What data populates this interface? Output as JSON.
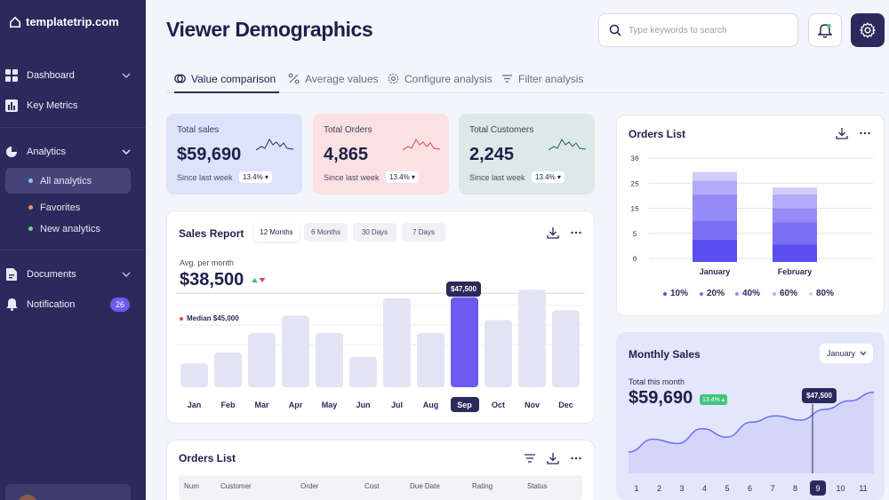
{
  "brand": {
    "name": "templatetrip.com"
  },
  "sidebar": {
    "dashboard": "Dashboard",
    "key_metrics": "Key Metrics",
    "analytics": "Analytics",
    "all_analytics": "All analytics",
    "favorites": "Favorites",
    "new_analytics": "New analytics",
    "documents": "Documents",
    "notification": "Notification",
    "notification_count": "26"
  },
  "header": {
    "title": "Viewer Demographics",
    "search_placeholder": "Type keywords to search"
  },
  "tabs": {
    "value_comparison": "Value comparison",
    "average_values": "Average values",
    "configure_analysis": "Configure analysis",
    "filter_analysis": "Filter analysis"
  },
  "stats": [
    {
      "title": "Total sales",
      "value": "$59,690",
      "since": "Since last week",
      "change": "13.4% ▾",
      "color": "#dde3fb"
    },
    {
      "title": "Total Orders",
      "value": "4,865",
      "since": "Since last week",
      "change": "13.4% ▾",
      "color": "#fbe1e1"
    },
    {
      "title": "Total Customers",
      "value": "2,245",
      "since": "Since last week",
      "change": "13.4% ▾",
      "color": "#dde9e6"
    }
  ],
  "sales_report": {
    "title": "Sales Report",
    "ranges": [
      "12 Months",
      "6 Months",
      "30 Days",
      "7 Days"
    ],
    "selected_range": "12 Months",
    "avg_label": "Avg. per month",
    "avg_value": "$38,500",
    "median_label": "Median $45,000",
    "tooltip": "$47,500",
    "selected_month": "Sep"
  },
  "orders_table": {
    "title": "Orders List",
    "columns": [
      "Num",
      "Customer",
      "Order",
      "Cost",
      "Due Date",
      "Rating",
      "Status"
    ]
  },
  "orders_chart": {
    "title": "Orders List",
    "categories": [
      "January",
      "February"
    ],
    "yticks": [
      "30",
      "25",
      "15",
      "5",
      "0"
    ],
    "legend": [
      "10%",
      "20%",
      "40%",
      "60%",
      "80%"
    ],
    "colors": [
      "#5b4ef0",
      "#7a6ef5",
      "#958bf7",
      "#b2abf9",
      "#d2cefb"
    ]
  },
  "monthly_sales": {
    "title": "Monthly Sales",
    "month_select": "January",
    "total_label": "Total this month",
    "total_value": "$59,690",
    "change": "13.4% ▴",
    "tooltip": "$47,500",
    "pages": [
      "1",
      "2",
      "3",
      "4",
      "5",
      "6",
      "7",
      "8",
      "9",
      "10",
      "11"
    ],
    "selected_page": "9"
  },
  "chart_data": [
    {
      "type": "bar",
      "categories": [
        "Jan",
        "Feb",
        "Mar",
        "Apr",
        "May",
        "Jun",
        "Jul",
        "Aug",
        "Sep",
        "Oct",
        "Nov",
        "Dec"
      ],
      "values": [
        11000,
        16000,
        25000,
        33000,
        25000,
        14000,
        41000,
        25000,
        41500,
        31000,
        45000,
        35500
      ],
      "highlight": "Sep",
      "reference_line": 45000,
      "title": "Sales Report"
    },
    {
      "type": "bar",
      "stacked": true,
      "categories": [
        "January",
        "February"
      ],
      "series": [
        {
          "name": "10%",
          "values": [
            6.5,
            5
          ]
        },
        {
          "name": "20%",
          "values": [
            5.5,
            6.5
          ]
        },
        {
          "name": "40%",
          "values": [
            7.5,
            4
          ]
        },
        {
          "name": "60%",
          "values": [
            4,
            4
          ]
        },
        {
          "name": "80%",
          "values": [
            2.5,
            2
          ]
        }
      ],
      "ylim": [
        0,
        30
      ],
      "title": "Orders List"
    },
    {
      "type": "area",
      "x": [
        "1",
        "2",
        "3",
        "4",
        "5",
        "6",
        "7",
        "8",
        "9",
        "10",
        "11"
      ],
      "values": [
        20,
        26,
        24,
        31,
        27,
        34,
        37,
        35,
        40,
        44,
        48
      ],
      "highlight_x": "9",
      "title": "Monthly Sales"
    }
  ]
}
